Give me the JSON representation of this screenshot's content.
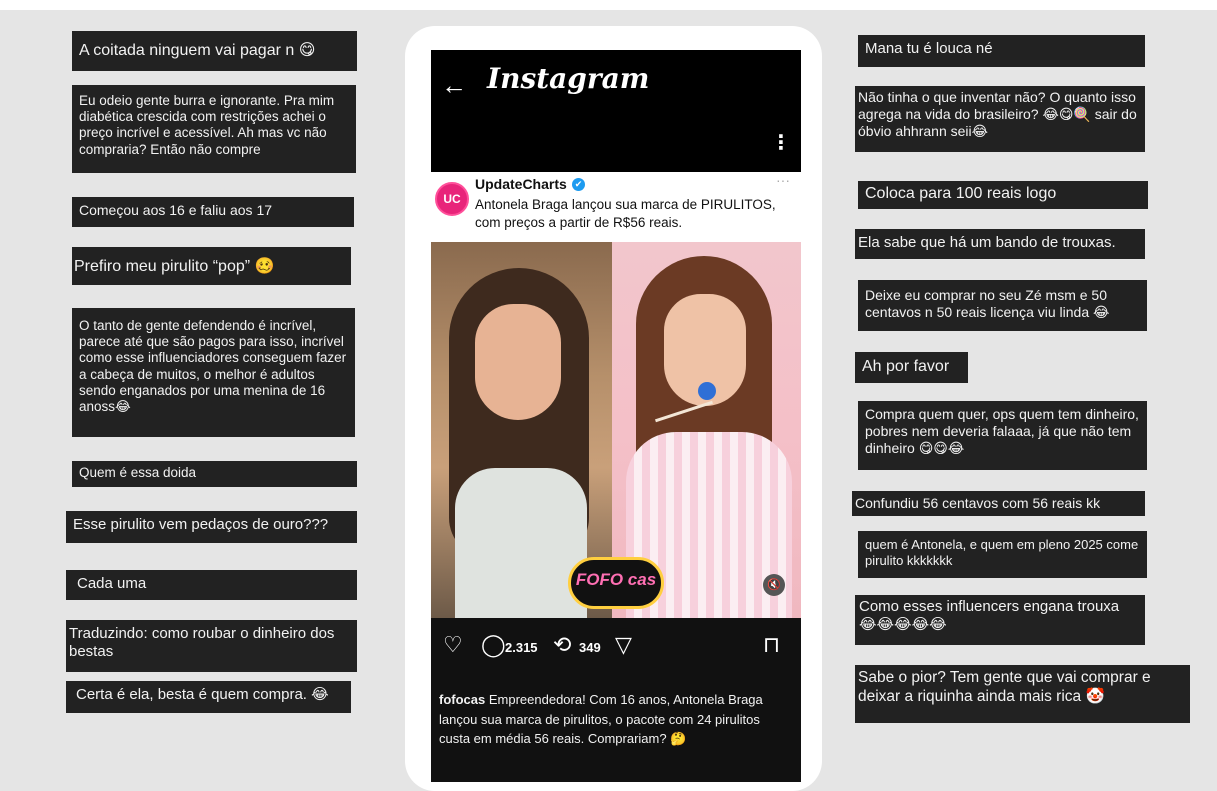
{
  "comments_left": [
    "A coitada ninguem vai pagar n 😋",
    "Eu odeio gente burra e ignorante. Pra mim diabética crescida com restrições achei o preço incrível e acessível. Ah mas vc não compraria? Então não compre",
    "Começou aos 16 e faliu aos 17",
    "Prefiro meu pirulito “pop” 🥴",
    "O tanto de gente defendendo é incrível, parece até que são pagos para isso, incrível como esse influenciadores conseguem fazer a cabeça de muitos, o melhor é adultos sendo enganados por uma menina de 16 anoss😂",
    "Quem é essa doida",
    "Esse pirulito vem pedaços de ouro???",
    "Cada uma",
    "Traduzindo: como roubar o dinheiro dos bestas",
    "Certa é ela, besta é quem compra. 😂"
  ],
  "comments_right": [
    "Mana tu é louca né",
    "Não tinha o que inventar não? O quanto isso agrega na vida do brasileiro? 😂😋🍭 sair do óbvio ahhrann seii😂",
    "Coloca para 100 reais logo",
    "Ela sabe que há um bando de trouxas.",
    "Deixe eu comprar no seu Zé msm e 50 centavos n 50 reais licença viu linda 😂",
    "Ah por favor",
    "Compra quem quer, ops quem tem dinheiro, pobres nem deveria falaaa, já que não tem dinheiro 😋😋😂",
    "Confundiu 56 centavos com 56 reais kk",
    "quem é Antonela, e quem em pleno 2025 come pirulito kkkkkkk",
    "Como esses influencers engana trouxa 😂😂😂😂😂",
    "Sabe o pior? Tem gente que vai comprar e deixar a riquinha ainda mais rica 🤡"
  ],
  "instagram": {
    "back_icon": "←",
    "app_title": "Instagram",
    "more_icon": "⋮",
    "post": {
      "avatar_text": "UC",
      "account": "UpdateCharts",
      "verified_icon": "✔",
      "dots": "···",
      "text": "Antonela Braga lançou sua marca de PIRULITOS, com preços a partir de R$56 reais.",
      "watermark": "FOFO cas",
      "mute_icon": "🔇"
    },
    "actions": {
      "like_icon": "♡",
      "comment_icon": "◯",
      "comments": "2.315",
      "repost_icon": "⟲",
      "reposts": "349",
      "share_icon": "▽",
      "save_icon": "⊓"
    },
    "caption_user": "fofocas",
    "caption_text": "Empreendedora! Com 16 anos, Antonela Braga lançou sua marca de pirulitos, o pacote com 24 pirulitos custa em média 56 reais. Comprariam? 🤔"
  },
  "colors": {
    "background": "#e5e5e5",
    "comment_box": "#222222",
    "avatar_pink": "#e8247a",
    "verified_blue": "#1d9bf0"
  }
}
